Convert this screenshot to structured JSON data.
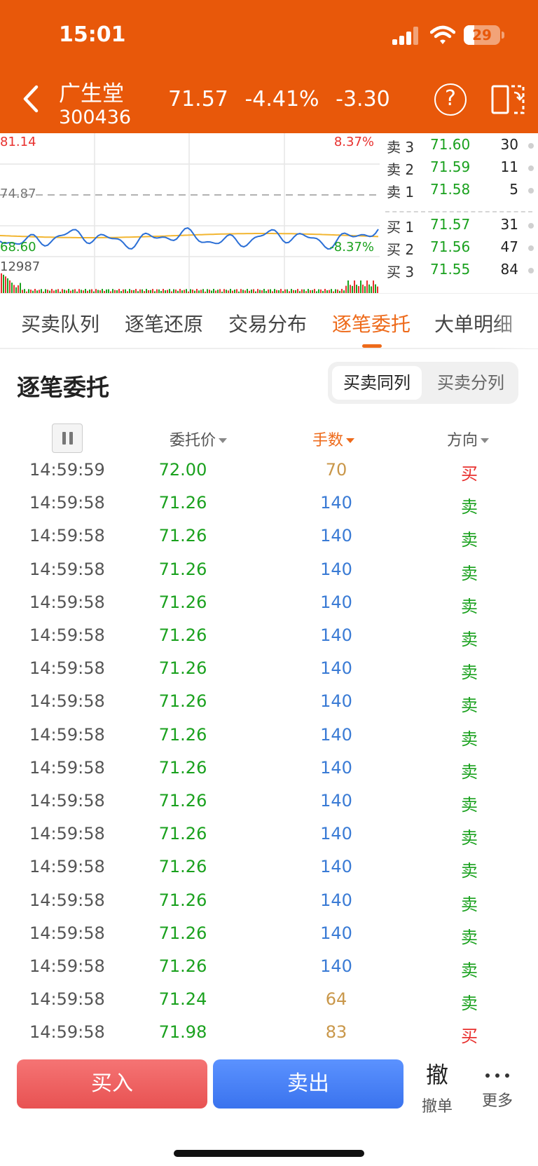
{
  "status_bar": {
    "time": "15:01",
    "battery": "29",
    "battery_level": 0.29
  },
  "stock": {
    "name": "广生堂",
    "code": "300436",
    "price": "71.57",
    "change_pct": "-4.41%",
    "change": "-3.30"
  },
  "chart": {
    "high_price": "81.14",
    "high_pct": "8.37%",
    "ref_price": "74.87",
    "low_price": "68.60",
    "low_pct": "-8.37%",
    "volume": "12987",
    "colors": {
      "price_line": "#2b6fd6",
      "avg_line": "#f2b632",
      "up": "#e8302e",
      "down": "#1aa11e"
    }
  },
  "order_book": {
    "asks": [
      {
        "label": "卖 3",
        "price": "71.60",
        "volume": "30"
      },
      {
        "label": "卖 2",
        "price": "71.59",
        "volume": "11"
      },
      {
        "label": "卖 1",
        "price": "71.58",
        "volume": "5"
      }
    ],
    "bids": [
      {
        "label": "买 1",
        "price": "71.57",
        "volume": "31"
      },
      {
        "label": "买 2",
        "price": "71.56",
        "volume": "47"
      },
      {
        "label": "买 3",
        "price": "71.55",
        "volume": "84"
      }
    ]
  },
  "tabs": [
    "买卖队列",
    "逐笔还原",
    "交易分布",
    "逐笔委托",
    "大单明细"
  ],
  "active_tab": "逐笔委托",
  "section": {
    "title": "逐笔委托",
    "toggle_same": "买卖同列",
    "toggle_split": "买卖分列"
  },
  "columns": {
    "price": "委托价",
    "volume": "手数",
    "direction": "方向"
  },
  "orders": [
    {
      "time": "14:59:59",
      "price": "72.00",
      "volume": "70",
      "direction": "买",
      "side": "buy"
    },
    {
      "time": "14:59:58",
      "price": "71.26",
      "volume": "140",
      "direction": "卖",
      "side": "sell"
    },
    {
      "time": "14:59:58",
      "price": "71.26",
      "volume": "140",
      "direction": "卖",
      "side": "sell"
    },
    {
      "time": "14:59:58",
      "price": "71.26",
      "volume": "140",
      "direction": "卖",
      "side": "sell"
    },
    {
      "time": "14:59:58",
      "price": "71.26",
      "volume": "140",
      "direction": "卖",
      "side": "sell"
    },
    {
      "time": "14:59:58",
      "price": "71.26",
      "volume": "140",
      "direction": "卖",
      "side": "sell"
    },
    {
      "time": "14:59:58",
      "price": "71.26",
      "volume": "140",
      "direction": "卖",
      "side": "sell"
    },
    {
      "time": "14:59:58",
      "price": "71.26",
      "volume": "140",
      "direction": "卖",
      "side": "sell"
    },
    {
      "time": "14:59:58",
      "price": "71.26",
      "volume": "140",
      "direction": "卖",
      "side": "sell"
    },
    {
      "time": "14:59:58",
      "price": "71.26",
      "volume": "140",
      "direction": "卖",
      "side": "sell"
    },
    {
      "time": "14:59:58",
      "price": "71.26",
      "volume": "140",
      "direction": "卖",
      "side": "sell"
    },
    {
      "time": "14:59:58",
      "price": "71.26",
      "volume": "140",
      "direction": "卖",
      "side": "sell"
    },
    {
      "time": "14:59:58",
      "price": "71.26",
      "volume": "140",
      "direction": "卖",
      "side": "sell"
    },
    {
      "time": "14:59:58",
      "price": "71.26",
      "volume": "140",
      "direction": "卖",
      "side": "sell"
    },
    {
      "time": "14:59:58",
      "price": "71.26",
      "volume": "140",
      "direction": "卖",
      "side": "sell"
    },
    {
      "time": "14:59:58",
      "price": "71.26",
      "volume": "140",
      "direction": "卖",
      "side": "sell"
    },
    {
      "time": "14:59:58",
      "price": "71.24",
      "volume": "64",
      "direction": "卖",
      "side": "sell"
    },
    {
      "time": "14:59:58",
      "price": "71.98",
      "volume": "83",
      "direction": "买",
      "side": "buy"
    }
  ],
  "colors": {
    "accent": "#ee6a1a",
    "header_bg": "#e8580a",
    "buy": "#e8302e",
    "sell": "#1aa11e",
    "small_volume": "#c9974a",
    "large_volume": "#3a7bd5"
  },
  "bottom_bar": {
    "buy": "买入",
    "sell": "卖出",
    "cancel_icon": "撤",
    "cancel": "撤单",
    "more": "更多"
  }
}
